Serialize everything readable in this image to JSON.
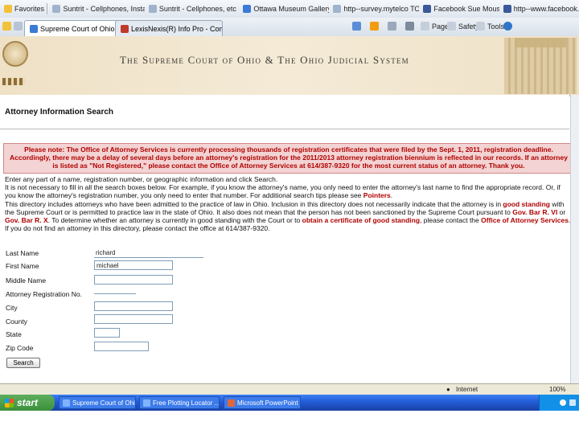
{
  "favorites": {
    "label": "Favorites",
    "items": [
      {
        "label": "Suntrit - Cellphones, Install ...",
        "icon": "page-icon"
      },
      {
        "label": "Suntrit - Cellphones, etc plan ...",
        "icon": "page-icon"
      },
      {
        "label": "Ottawa Museum Gallery",
        "icon": "ie-icon"
      },
      {
        "label": "http--survey.mytelco TOM ...",
        "icon": "page-icon"
      },
      {
        "label": "Facebook Sue Mouseer",
        "icon": "facebook-icon"
      },
      {
        "label": "http--www.facebook.com ...",
        "icon": "facebook-icon"
      }
    ]
  },
  "tabs": [
    {
      "label": "Supreme Court of Ohio P...",
      "active": true
    },
    {
      "label": "LexisNexis(R) Info Pro - Comm...",
      "active": false
    }
  ],
  "commandbar": {
    "page": "Page",
    "safety": "Safety",
    "tools": "Tools"
  },
  "banner": {
    "title": "The Supreme Court of Ohio & The Ohio Judicial System"
  },
  "main": {
    "page_title": "Attorney Information Search",
    "notice": "Please note: The Office of Attorney Services is currently processing thousands of registration certificates that were filed by the Sept. 1, 2011, registration deadline. Accordingly, there may be a delay of several days before an attorney's registration for the 2011/2013 attorney registration biennium is reflected in our records. If an attorney is listed as \"Not Registered,\" please contact the Office of Attorney Services at 614/387-9320 for the most current status of an attorney. Thank you.",
    "intro": "Enter any part of a name, registration number, or geographic information and click Search.",
    "help_text_a": "It is not necessary to fill in all the search boxes below. For example, if you know the attorney's name, you only need to enter the attorney's last name to find the appropriate record. Or, if you know the attorney's registration number, you only need to enter that number. For additional search tips please see ",
    "help_link": "Pointers",
    "disclaimer_a": "This directory includes attorneys who have been admitted to the practice of law in Ohio. Inclusion in this directory does not necessarily indicate that the attorney is in ",
    "disclaimer_b": "good standing",
    "disclaimer_c": " with the Supreme Court or is permitted to practice law in the state of Ohio. It also does not mean that the person has not been sanctioned by the Supreme Court pursuant to ",
    "disclaimer_d": "Gov. Bar R. VI",
    "disclaimer_e": " or ",
    "disclaimer_f": "Gov. Bar R. X",
    "disclaimer_g": ". To determine whether an attorney is currently in good standing with the Court or to ",
    "disclaimer_h": "obtain a certificate of good standing",
    "disclaimer_i": ", please contact the ",
    "disclaimer_j": "Office of Attorney Services",
    "disclaimer_k": ". If you do not find an attorney in this directory, please contact the office at 614/387-9320."
  },
  "form": {
    "last_name_label": "Last Name",
    "last_name_value": "richard",
    "first_name_label": "First Name",
    "first_name_value": "michael",
    "middle_name_label": "Middle Name",
    "middle_name_value": "",
    "reg_no_label": "Attorney Registration No.",
    "reg_no_value": "",
    "city_label": "City",
    "city_value": "",
    "county_label": "County",
    "county_value": "",
    "state_label": "State",
    "state_value": "",
    "zip_label": "Zip Code",
    "zip_value": "",
    "search_label": "Search"
  },
  "statusbar": {
    "zone": "Internet",
    "zoom": "100%"
  },
  "taskbar": {
    "start": "start",
    "items": [
      {
        "label": "Supreme Court of Ohi...",
        "icon": "ie-icon"
      },
      {
        "label": "Free Plotting Locator ...",
        "icon": "ie-icon"
      },
      {
        "label": "Microsoft PowerPoint ...",
        "icon": "powerpoint-icon"
      }
    ]
  },
  "colors": {
    "notice_text": "#b00000",
    "notice_bg": "#f3d3d3",
    "banner_bg": "#f1e5cd",
    "taskbar": "#245edb"
  }
}
